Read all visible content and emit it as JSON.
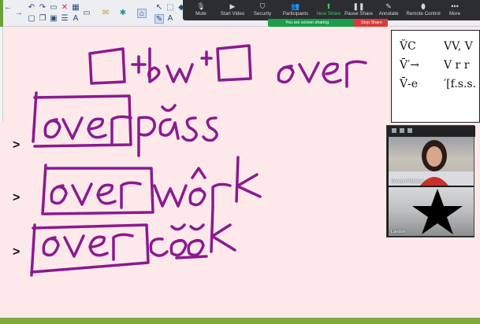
{
  "zoom_controls": {
    "items": [
      {
        "label": "Mute",
        "icon": "microphone-icon"
      },
      {
        "label": "Start Video",
        "icon": "video-camera-icon"
      },
      {
        "label": "Security",
        "icon": "shield-icon"
      },
      {
        "label": "Participants",
        "icon": "people-icon"
      },
      {
        "label": "New Share",
        "icon": "share-screen-icon"
      },
      {
        "label": "Pause Share",
        "icon": "pause-icon"
      },
      {
        "label": "Annotate",
        "icon": "pencil-icon"
      },
      {
        "label": "Remote Control",
        "icon": "mouse-icon"
      },
      {
        "label": "More",
        "icon": "ellipsis-icon"
      }
    ],
    "sharing_notice": "You are screen sharing",
    "stop_share_label": "Stop Share"
  },
  "reference_card": {
    "rows": [
      {
        "left": "V̆C",
        "right": "VV, V"
      },
      {
        "left": "V̄′→",
        "right": "V r r"
      },
      {
        "left": "V̄-e",
        "right": "′[f.s.s."
      }
    ]
  },
  "gallery": {
    "participants": [
      {
        "name": "Kenyon Robison",
        "video": "on"
      },
      {
        "name": "Landon",
        "video": "star-avatar"
      }
    ]
  },
  "whiteboard": {
    "formula": "□ + bw + □  over",
    "words": [
      {
        "prefix": "over",
        "base": "păss"
      },
      {
        "prefix": "over",
        "base": "wôrk"
      },
      {
        "prefix": "over",
        "base": "cŏŏk"
      }
    ],
    "bullet_marker": ">"
  },
  "colors": {
    "ink": "#8b1a8f",
    "canvas": "#fde9ea",
    "zoom_bar": "#2c2d30",
    "sharing_green": "#1a9e4b",
    "stop_red": "#d93b3b"
  }
}
